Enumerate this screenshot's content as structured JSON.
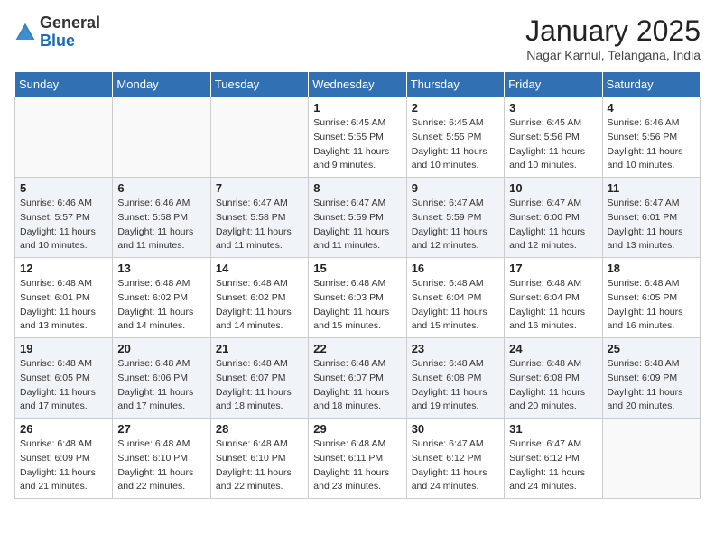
{
  "logo": {
    "general": "General",
    "blue": "Blue"
  },
  "header": {
    "month": "January 2025",
    "location": "Nagar Karnul, Telangana, India"
  },
  "weekdays": [
    "Sunday",
    "Monday",
    "Tuesday",
    "Wednesday",
    "Thursday",
    "Friday",
    "Saturday"
  ],
  "weeks": [
    [
      {
        "day": "",
        "sunrise": "",
        "sunset": "",
        "daylight": ""
      },
      {
        "day": "",
        "sunrise": "",
        "sunset": "",
        "daylight": ""
      },
      {
        "day": "",
        "sunrise": "",
        "sunset": "",
        "daylight": ""
      },
      {
        "day": "1",
        "sunrise": "Sunrise: 6:45 AM",
        "sunset": "Sunset: 5:55 PM",
        "daylight": "Daylight: 11 hours and 9 minutes."
      },
      {
        "day": "2",
        "sunrise": "Sunrise: 6:45 AM",
        "sunset": "Sunset: 5:55 PM",
        "daylight": "Daylight: 11 hours and 10 minutes."
      },
      {
        "day": "3",
        "sunrise": "Sunrise: 6:45 AM",
        "sunset": "Sunset: 5:56 PM",
        "daylight": "Daylight: 11 hours and 10 minutes."
      },
      {
        "day": "4",
        "sunrise": "Sunrise: 6:46 AM",
        "sunset": "Sunset: 5:56 PM",
        "daylight": "Daylight: 11 hours and 10 minutes."
      }
    ],
    [
      {
        "day": "5",
        "sunrise": "Sunrise: 6:46 AM",
        "sunset": "Sunset: 5:57 PM",
        "daylight": "Daylight: 11 hours and 10 minutes."
      },
      {
        "day": "6",
        "sunrise": "Sunrise: 6:46 AM",
        "sunset": "Sunset: 5:58 PM",
        "daylight": "Daylight: 11 hours and 11 minutes."
      },
      {
        "day": "7",
        "sunrise": "Sunrise: 6:47 AM",
        "sunset": "Sunset: 5:58 PM",
        "daylight": "Daylight: 11 hours and 11 minutes."
      },
      {
        "day": "8",
        "sunrise": "Sunrise: 6:47 AM",
        "sunset": "Sunset: 5:59 PM",
        "daylight": "Daylight: 11 hours and 11 minutes."
      },
      {
        "day": "9",
        "sunrise": "Sunrise: 6:47 AM",
        "sunset": "Sunset: 5:59 PM",
        "daylight": "Daylight: 11 hours and 12 minutes."
      },
      {
        "day": "10",
        "sunrise": "Sunrise: 6:47 AM",
        "sunset": "Sunset: 6:00 PM",
        "daylight": "Daylight: 11 hours and 12 minutes."
      },
      {
        "day": "11",
        "sunrise": "Sunrise: 6:47 AM",
        "sunset": "Sunset: 6:01 PM",
        "daylight": "Daylight: 11 hours and 13 minutes."
      }
    ],
    [
      {
        "day": "12",
        "sunrise": "Sunrise: 6:48 AM",
        "sunset": "Sunset: 6:01 PM",
        "daylight": "Daylight: 11 hours and 13 minutes."
      },
      {
        "day": "13",
        "sunrise": "Sunrise: 6:48 AM",
        "sunset": "Sunset: 6:02 PM",
        "daylight": "Daylight: 11 hours and 14 minutes."
      },
      {
        "day": "14",
        "sunrise": "Sunrise: 6:48 AM",
        "sunset": "Sunset: 6:02 PM",
        "daylight": "Daylight: 11 hours and 14 minutes."
      },
      {
        "day": "15",
        "sunrise": "Sunrise: 6:48 AM",
        "sunset": "Sunset: 6:03 PM",
        "daylight": "Daylight: 11 hours and 15 minutes."
      },
      {
        "day": "16",
        "sunrise": "Sunrise: 6:48 AM",
        "sunset": "Sunset: 6:04 PM",
        "daylight": "Daylight: 11 hours and 15 minutes."
      },
      {
        "day": "17",
        "sunrise": "Sunrise: 6:48 AM",
        "sunset": "Sunset: 6:04 PM",
        "daylight": "Daylight: 11 hours and 16 minutes."
      },
      {
        "day": "18",
        "sunrise": "Sunrise: 6:48 AM",
        "sunset": "Sunset: 6:05 PM",
        "daylight": "Daylight: 11 hours and 16 minutes."
      }
    ],
    [
      {
        "day": "19",
        "sunrise": "Sunrise: 6:48 AM",
        "sunset": "Sunset: 6:05 PM",
        "daylight": "Daylight: 11 hours and 17 minutes."
      },
      {
        "day": "20",
        "sunrise": "Sunrise: 6:48 AM",
        "sunset": "Sunset: 6:06 PM",
        "daylight": "Daylight: 11 hours and 17 minutes."
      },
      {
        "day": "21",
        "sunrise": "Sunrise: 6:48 AM",
        "sunset": "Sunset: 6:07 PM",
        "daylight": "Daylight: 11 hours and 18 minutes."
      },
      {
        "day": "22",
        "sunrise": "Sunrise: 6:48 AM",
        "sunset": "Sunset: 6:07 PM",
        "daylight": "Daylight: 11 hours and 18 minutes."
      },
      {
        "day": "23",
        "sunrise": "Sunrise: 6:48 AM",
        "sunset": "Sunset: 6:08 PM",
        "daylight": "Daylight: 11 hours and 19 minutes."
      },
      {
        "day": "24",
        "sunrise": "Sunrise: 6:48 AM",
        "sunset": "Sunset: 6:08 PM",
        "daylight": "Daylight: 11 hours and 20 minutes."
      },
      {
        "day": "25",
        "sunrise": "Sunrise: 6:48 AM",
        "sunset": "Sunset: 6:09 PM",
        "daylight": "Daylight: 11 hours and 20 minutes."
      }
    ],
    [
      {
        "day": "26",
        "sunrise": "Sunrise: 6:48 AM",
        "sunset": "Sunset: 6:09 PM",
        "daylight": "Daylight: 11 hours and 21 minutes."
      },
      {
        "day": "27",
        "sunrise": "Sunrise: 6:48 AM",
        "sunset": "Sunset: 6:10 PM",
        "daylight": "Daylight: 11 hours and 22 minutes."
      },
      {
        "day": "28",
        "sunrise": "Sunrise: 6:48 AM",
        "sunset": "Sunset: 6:10 PM",
        "daylight": "Daylight: 11 hours and 22 minutes."
      },
      {
        "day": "29",
        "sunrise": "Sunrise: 6:48 AM",
        "sunset": "Sunset: 6:11 PM",
        "daylight": "Daylight: 11 hours and 23 minutes."
      },
      {
        "day": "30",
        "sunrise": "Sunrise: 6:47 AM",
        "sunset": "Sunset: 6:12 PM",
        "daylight": "Daylight: 11 hours and 24 minutes."
      },
      {
        "day": "31",
        "sunrise": "Sunrise: 6:47 AM",
        "sunset": "Sunset: 6:12 PM",
        "daylight": "Daylight: 11 hours and 24 minutes."
      },
      {
        "day": "",
        "sunrise": "",
        "sunset": "",
        "daylight": ""
      }
    ]
  ]
}
